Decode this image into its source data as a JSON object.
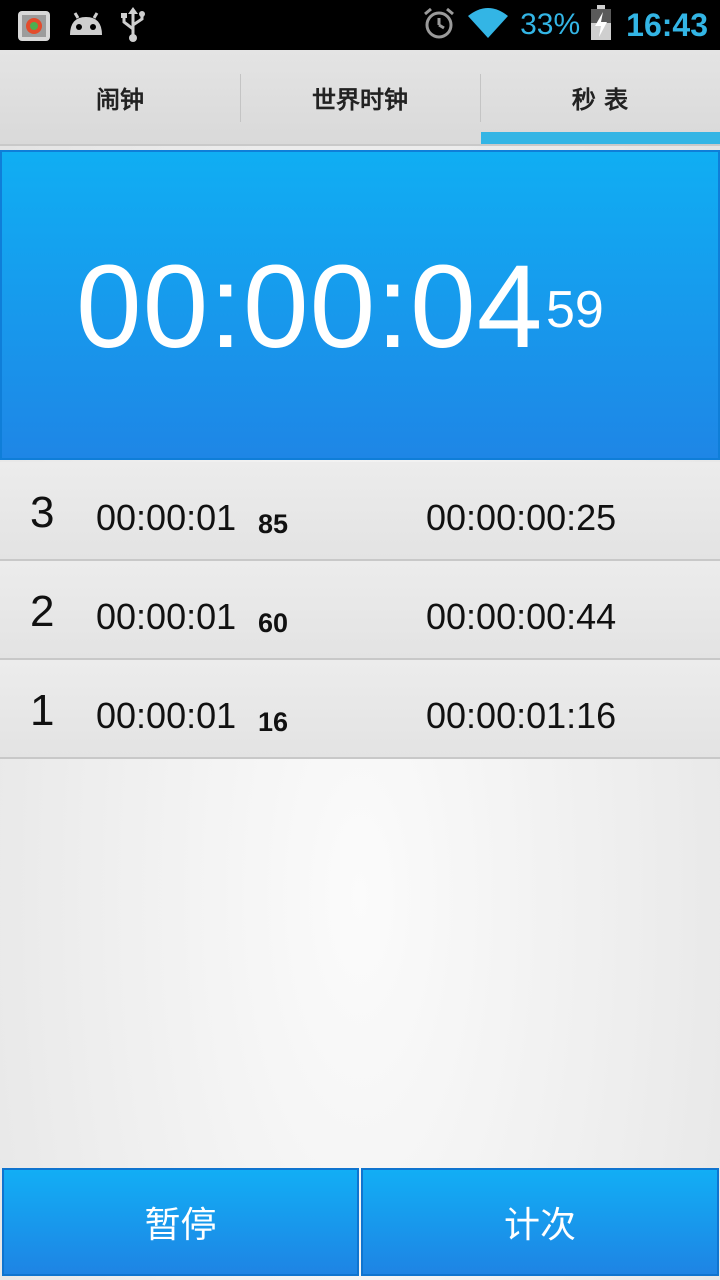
{
  "status_bar": {
    "battery_text": "33%",
    "clock": "16:43",
    "icons": [
      "app-notification-icon",
      "android-icon",
      "usb-icon",
      "alarm-icon",
      "wifi-icon",
      "battery-charging-icon"
    ],
    "accent_color": "#33b5e5"
  },
  "tabs": [
    {
      "label": "闹钟",
      "selected": false
    },
    {
      "label": "世界时钟",
      "selected": false
    },
    {
      "label": "秒 表",
      "selected": true
    }
  ],
  "stopwatch": {
    "main_time": "00:00:04",
    "fraction": "59"
  },
  "laps": [
    {
      "number": "3",
      "lap_time": "00:00:01",
      "lap_fraction": "85",
      "total": "00:00:00:25"
    },
    {
      "number": "2",
      "lap_time": "00:00:01",
      "lap_fraction": "60",
      "total": "00:00:00:44"
    },
    {
      "number": "1",
      "lap_time": "00:00:01",
      "lap_fraction": "16",
      "total": "00:00:01:16"
    }
  ],
  "buttons": {
    "pause_label": "暂停",
    "lap_label": "计次"
  },
  "colors": {
    "primary_blue": "#1a9cf0",
    "tab_indicator": "#33b5e5"
  }
}
